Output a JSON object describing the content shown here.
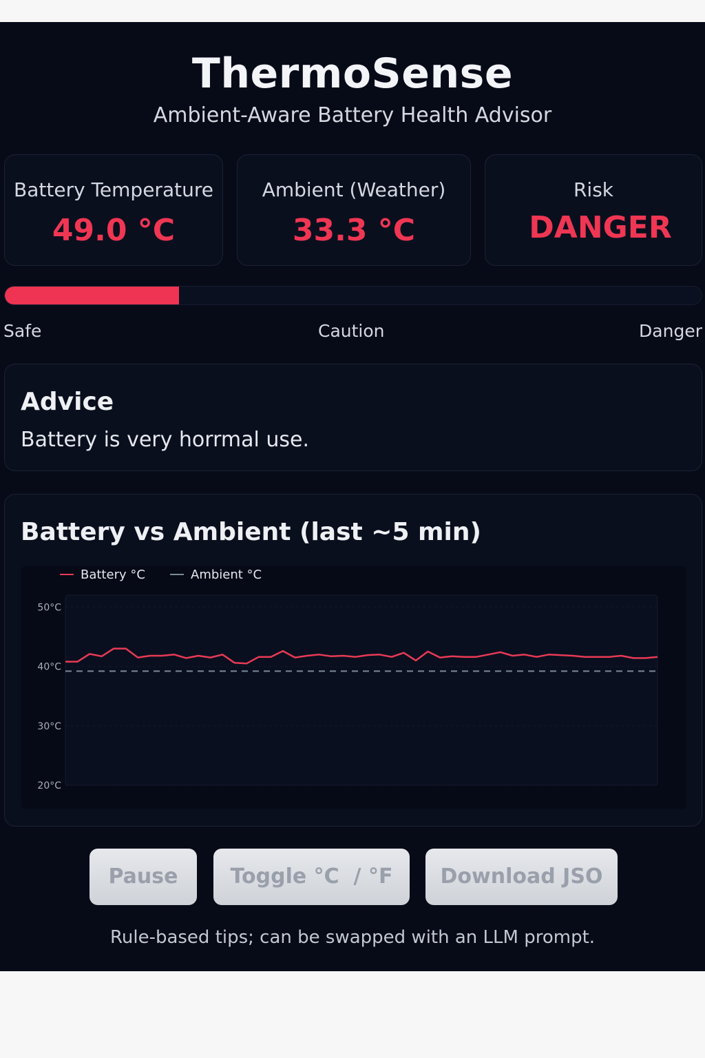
{
  "header": {
    "title": "ThermoSense",
    "subtitle": "Ambient-Aware Battery Health Advisor"
  },
  "stats": {
    "battery": {
      "label": "Battery Temperature",
      "value": "49.0 °C"
    },
    "ambient": {
      "label": "Ambient (Weather)",
      "value": "33.3 °C"
    },
    "risk": {
      "label": "Risk",
      "value": "DANGER"
    }
  },
  "risk_meter": {
    "fill_fraction": 0.25,
    "labels": {
      "safe": "Safe",
      "caution": "Caution",
      "danger": "Danger"
    },
    "color": "#ee3452"
  },
  "advice": {
    "heading": "Advice",
    "text": "Battery is very horrmal use."
  },
  "chart_panel": {
    "heading": "Battery vs Ambient (last ~5 min)"
  },
  "chart_data": {
    "type": "line",
    "title": "Battery vs Ambient (last ~5 min)",
    "ylim": [
      20,
      52
    ],
    "yticks": [
      {
        "value": 50,
        "label": "50°C"
      },
      {
        "value": 40,
        "label": "40°C"
      },
      {
        "value": 30,
        "label": "30°C"
      },
      {
        "value": 20,
        "label": "20°C"
      }
    ],
    "grid": true,
    "legend": "top-left",
    "series": [
      {
        "name": "Battery °C",
        "color": "#e83a55",
        "style": "solid",
        "values": [
          40.8,
          40.8,
          42.1,
          41.7,
          43.0,
          43.0,
          41.5,
          41.8,
          41.8,
          42.0,
          41.4,
          41.8,
          41.5,
          42.0,
          40.6,
          40.5,
          41.6,
          41.6,
          42.6,
          41.5,
          41.8,
          42.0,
          41.7,
          41.8,
          41.6,
          41.9,
          42.0,
          41.6,
          42.3,
          41.0,
          42.5,
          41.5,
          41.7,
          41.6,
          41.6,
          42.0,
          42.4,
          41.8,
          42.0,
          41.6,
          42.0,
          41.9,
          41.8,
          41.6,
          41.6,
          41.6,
          41.8,
          41.4,
          41.4,
          41.6
        ]
      },
      {
        "name": "Ambient °C",
        "color": "#7d8a96",
        "style": "dashed",
        "values": [
          39.2,
          39.2
        ]
      }
    ]
  },
  "buttons": {
    "pause": "Pause",
    "toggle": "Toggle °C  / °F",
    "download": "Download JSO"
  },
  "footer": {
    "note": "Rule-based tips; can be swapped with an LLM prompt."
  }
}
